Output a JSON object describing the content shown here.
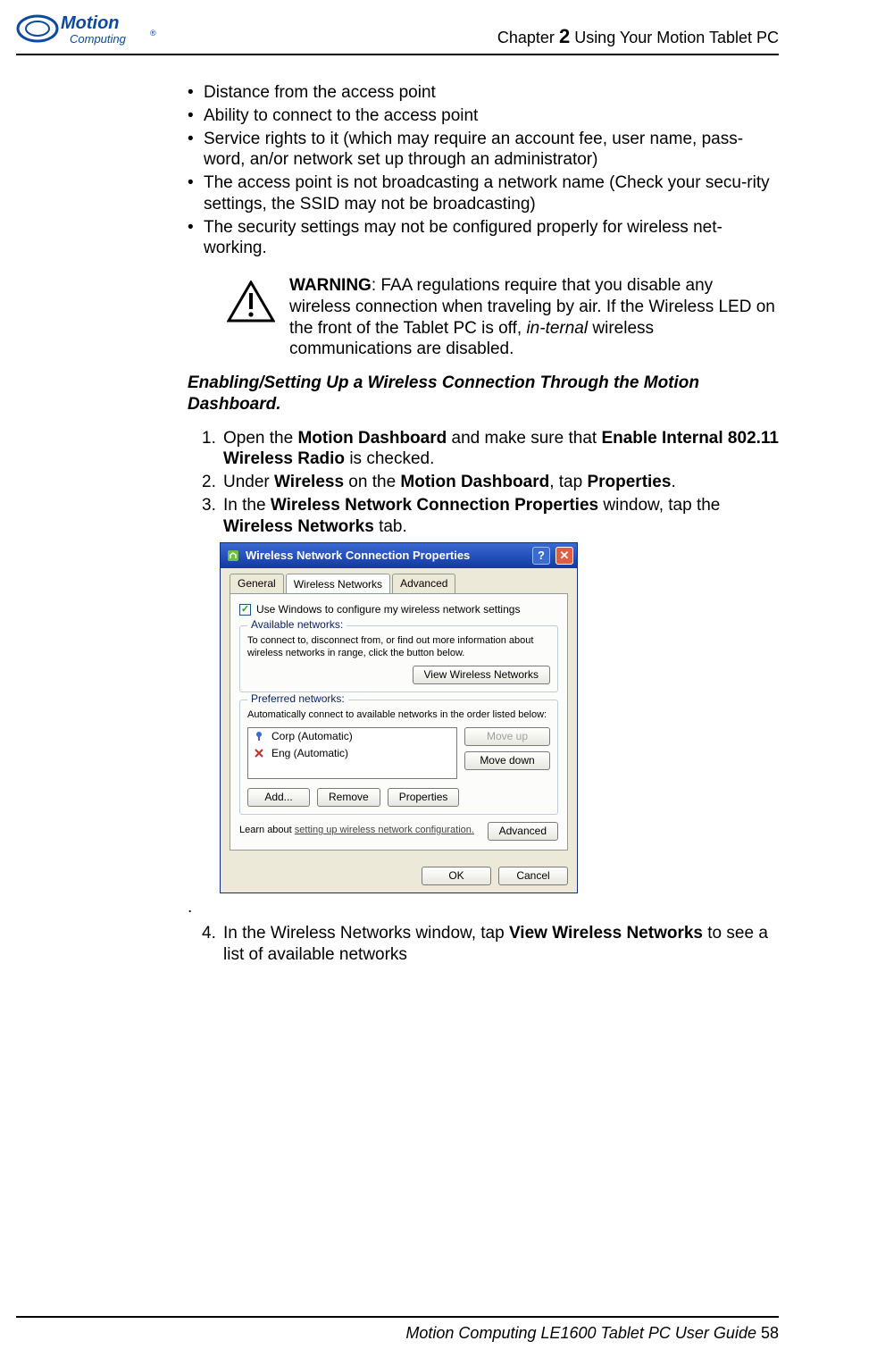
{
  "header": {
    "logo_line1": "Motion",
    "logo_line2": "Computing",
    "chapter_prefix": "Chapter ",
    "chapter_number": "2",
    "chapter_title": "  Using Your Motion Tablet PC"
  },
  "bullets": [
    "Distance from the access point",
    "Ability to connect to the access point",
    "Service rights to it (which may require an account fee, user name, pass-word, an/or network set up through an administrator)",
    "The access point is not broadcasting a network name (Check your secu-rity settings, the SSID may not be broadcasting)",
    "The security settings may not be configured properly for wireless net-working."
  ],
  "warning": {
    "label": "WARNING",
    "text": ": FAA regulations require that you disable any wireless connection when traveling by air. If the Wireless LED on the front of the Tablet PC is off, ",
    "ital": "in-ternal",
    "tail": " wireless communications are disabled."
  },
  "section_heading": "Enabling/Setting Up a Wireless Connection Through the Motion Dashboard.",
  "steps": {
    "s1": {
      "pre": "Open the ",
      "b1": "Motion Dashboard",
      "mid": " and make sure that ",
      "b2": "Enable Internal 802.11 Wireless Radio",
      "post": " is checked."
    },
    "s2": {
      "pre": "Under ",
      "b1": "Wireless",
      "mid": " on the ",
      "b2": "Motion Dashboard",
      "mid2": ", tap ",
      "b3": "Properties",
      "post": "."
    },
    "s3": {
      "pre": "In the ",
      "b1": "Wireless Network Connection Properties",
      "mid": " window, tap the ",
      "b2": "Wireless Networks",
      "post": " tab."
    },
    "s4": {
      "pre": "In the Wireless Networks window, tap ",
      "b1": "View Wireless Networks",
      "post": " to see a list of available networks"
    }
  },
  "period": ".",
  "dialog": {
    "title": "Wireless Network Connection Properties",
    "tabs": {
      "general": "General",
      "wireless": "Wireless Networks",
      "advanced": "Advanced"
    },
    "use_windows": "Use Windows to configure my wireless network settings",
    "available": {
      "legend": "Available networks:",
      "desc": "To connect to, disconnect from, or find out more information about wireless networks in range, click the button below.",
      "view_btn": "View Wireless Networks"
    },
    "preferred": {
      "legend": "Preferred networks:",
      "desc": "Automatically connect to available networks in the order listed below:",
      "items": [
        "Corp (Automatic)",
        "Eng (Automatic)"
      ],
      "move_up": "Move up",
      "move_down": "Move down",
      "add": "Add...",
      "remove": "Remove",
      "properties": "Properties"
    },
    "learn_pre": "Learn about ",
    "learn_link": "setting up wireless network configuration.",
    "advanced_btn": "Advanced",
    "ok": "OK",
    "cancel": "Cancel"
  },
  "footer": {
    "text": "Motion Computing LE1600 Tablet PC User Guide ",
    "page": "58"
  }
}
